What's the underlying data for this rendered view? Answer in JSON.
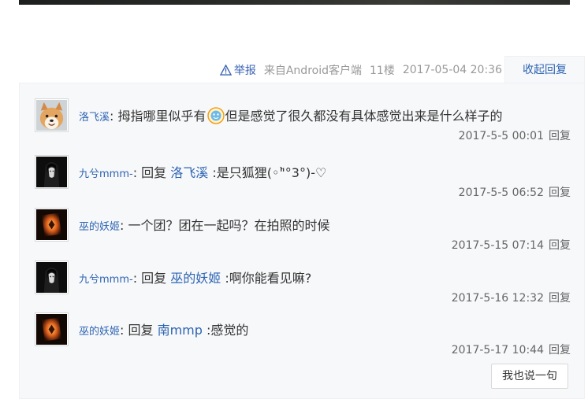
{
  "post_meta": {
    "report_label": "举报",
    "source": "来自Android客户端",
    "floor": "11楼",
    "datetime": "2017-05-04 20:36",
    "collapse_label": "收起回复"
  },
  "replies": [
    {
      "username": "洛飞溪",
      "separator": ":",
      "text_before": " 拇指哪里似乎有",
      "emoji": "smiley-emoji",
      "text_after": "但是感觉了很久都没有具体感觉出来是什么样子的",
      "time": "2017-5-5 00:01",
      "reply_label": "回复",
      "avatar": "shiba-dog-avatar"
    },
    {
      "username": "九兮mmm-",
      "separator": ":",
      "reply_word": " 回复 ",
      "target": "洛飞溪",
      "text": " :是只狐狸(﻿◦\"̀°3°)-♡",
      "time": "2017-5-5 06:52",
      "reply_label": "回复",
      "avatar": "dark-girl-avatar"
    },
    {
      "username": "巫的妖姬",
      "separator": ":",
      "text": " 一个团？团在一起吗？在拍照的时候",
      "time": "2017-5-15 07:14",
      "reply_label": "回复",
      "avatar": "fire-card-avatar"
    },
    {
      "username": "九兮mmm-",
      "separator": ":",
      "reply_word": " 回复 ",
      "target": "巫的妖姬",
      "text": " :啊你能看见嘛?",
      "time": "2017-5-16 12:32",
      "reply_label": "回复",
      "avatar": "dark-girl-avatar"
    },
    {
      "username": "巫的妖姬",
      "separator": ":",
      "reply_word": " 回复 ",
      "target": "南mmp",
      "text": " :感觉的",
      "time": "2017-5-17 10:44",
      "reply_label": "回复",
      "avatar": "fire-card-avatar"
    }
  ],
  "say_button": "我也说一句",
  "colors": {
    "link": "#2d64b3",
    "meta": "#999999",
    "panel": "#f7f8fa"
  }
}
